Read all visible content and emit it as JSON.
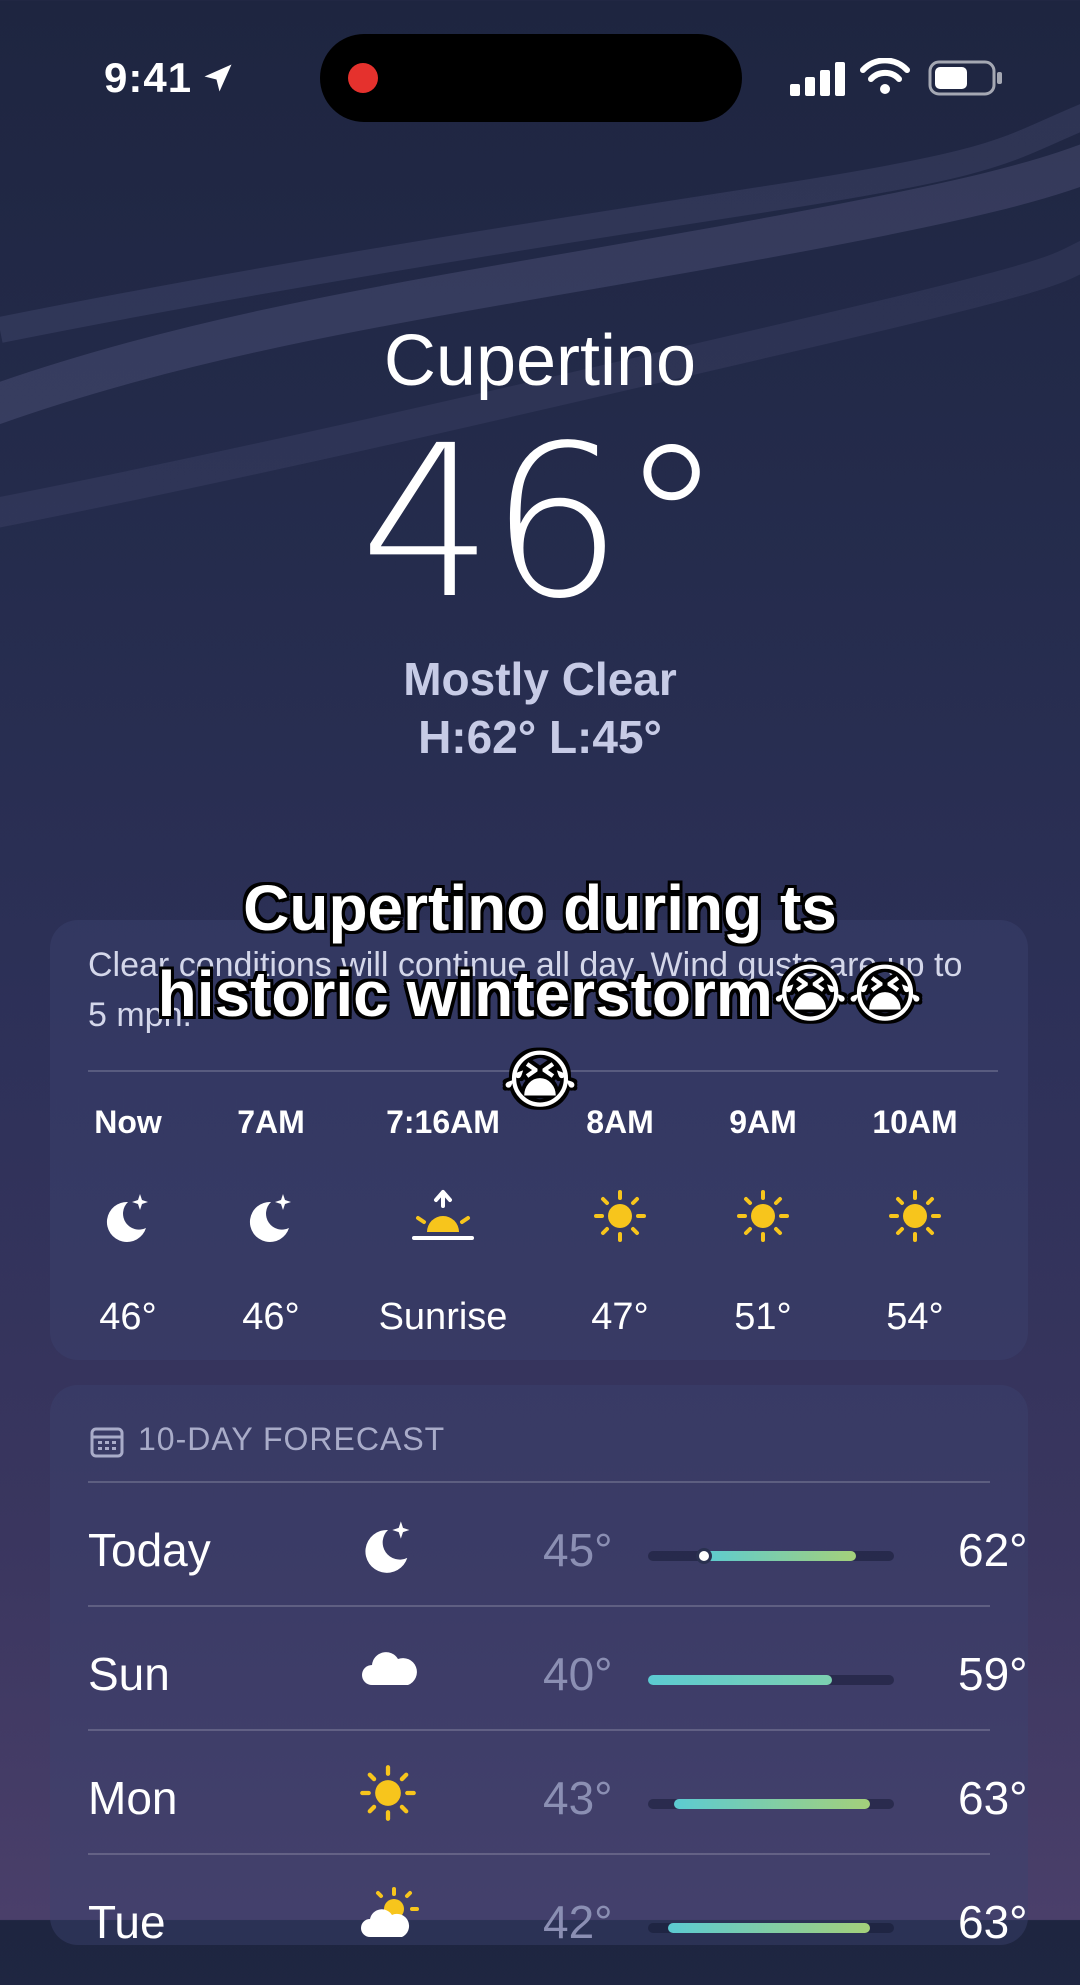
{
  "status_bar": {
    "time": "9:41"
  },
  "weather": {
    "city": "Cupertino",
    "temperature": "46°",
    "condition": "Mostly Clear",
    "high_low": "H:62°  L:45°"
  },
  "hourly": {
    "description": "Clear conditions will continue all day. Wind gusts are up to 5 mph.",
    "items": [
      {
        "time": "Now",
        "icon": "moon-stars-icon",
        "temp": "46°"
      },
      {
        "time": "7AM",
        "icon": "moon-stars-icon",
        "temp": "46°"
      },
      {
        "time": "7:16AM",
        "icon": "sunrise-icon",
        "temp": "Sunrise"
      },
      {
        "time": "8AM",
        "icon": "sun-icon",
        "temp": "47°"
      },
      {
        "time": "9AM",
        "icon": "sun-icon",
        "temp": "51°"
      },
      {
        "time": "10AM",
        "icon": "sun-icon",
        "temp": "54°"
      }
    ]
  },
  "forecast": {
    "header": "10-DAY FORECAST",
    "days": [
      {
        "day": "Today",
        "icon": "moon-stars-icon",
        "low": "45°",
        "high": "62°",
        "current_marker": true
      },
      {
        "day": "Sun",
        "icon": "cloud-icon",
        "low": "40°",
        "high": "59°"
      },
      {
        "day": "Mon",
        "icon": "sun-icon",
        "low": "43°",
        "high": "63°"
      },
      {
        "day": "Tue",
        "icon": "partly-sunny-icon",
        "low": "42°",
        "high": "63°"
      }
    ]
  },
  "overlay": {
    "caption_line1": "Cupertino during ts",
    "caption_line2": "historic winterstorm😭😭",
    "caption_line3": "😭"
  },
  "colors": {
    "recording_dot": "#e5312d",
    "sun_yellow": "#f7c51c",
    "bar_cool": "#5ccbd2",
    "bar_warm": "#a4d07a"
  }
}
